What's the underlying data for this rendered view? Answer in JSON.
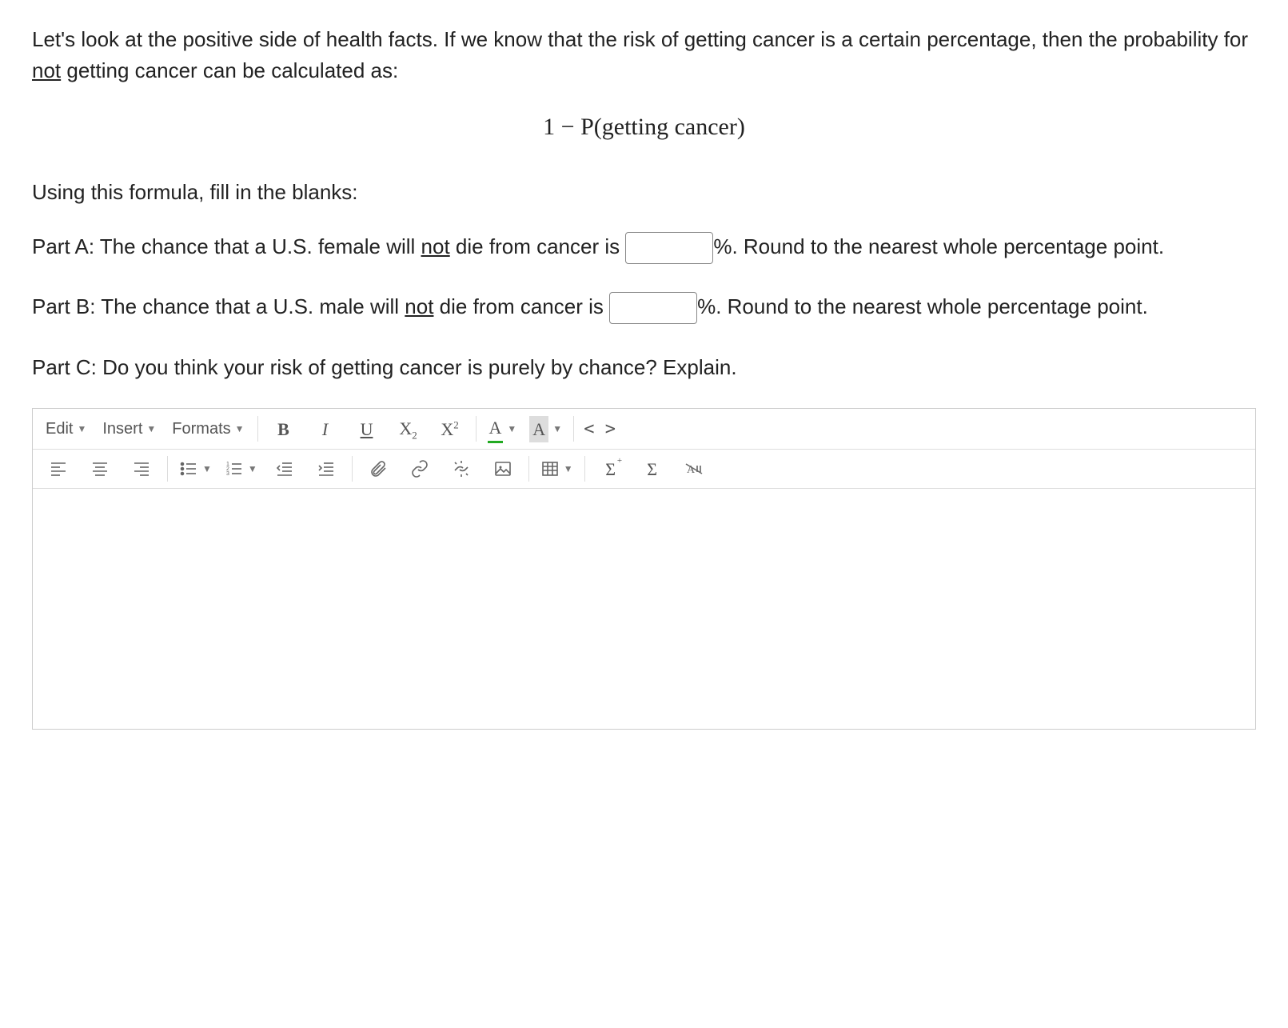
{
  "intro": {
    "line1_a": "Let's look at the positive side of health facts. If we know that the risk of getting cancer is a certain percentage, then the probability for ",
    "line1_not": "not",
    "line1_b": " getting cancer can be calculated as:"
  },
  "formula": "1 − P(getting cancer)",
  "instruction": "Using this formula, fill in the blanks:",
  "partA": {
    "pre": "Part A: The chance that a U.S. female will ",
    "not": "not",
    "mid": " die from cancer is ",
    "post": "%. Round to the nearest whole percentage point.",
    "value": ""
  },
  "partB": {
    "pre": "Part B: The chance that a U.S. male will ",
    "not": "not",
    "mid": " die from cancer is ",
    "post": "%. Round to the nearest whole percentage point.",
    "value": ""
  },
  "partC": "Part C: Do you think your risk of getting cancer is purely by chance? Explain.",
  "editor": {
    "menus": {
      "edit": "Edit",
      "insert": "Insert",
      "formats": "Formats"
    },
    "buttons": {
      "bold": "B",
      "italic": "I",
      "underline": "U",
      "sub_base": "X",
      "sub_sub": "2",
      "sup_base": "X",
      "sup_sup": "2",
      "textcolor": "A",
      "bgcolor": "A",
      "code": "< >",
      "sigma_plus": "Σ",
      "sigma": "Σ"
    },
    "body": ""
  }
}
